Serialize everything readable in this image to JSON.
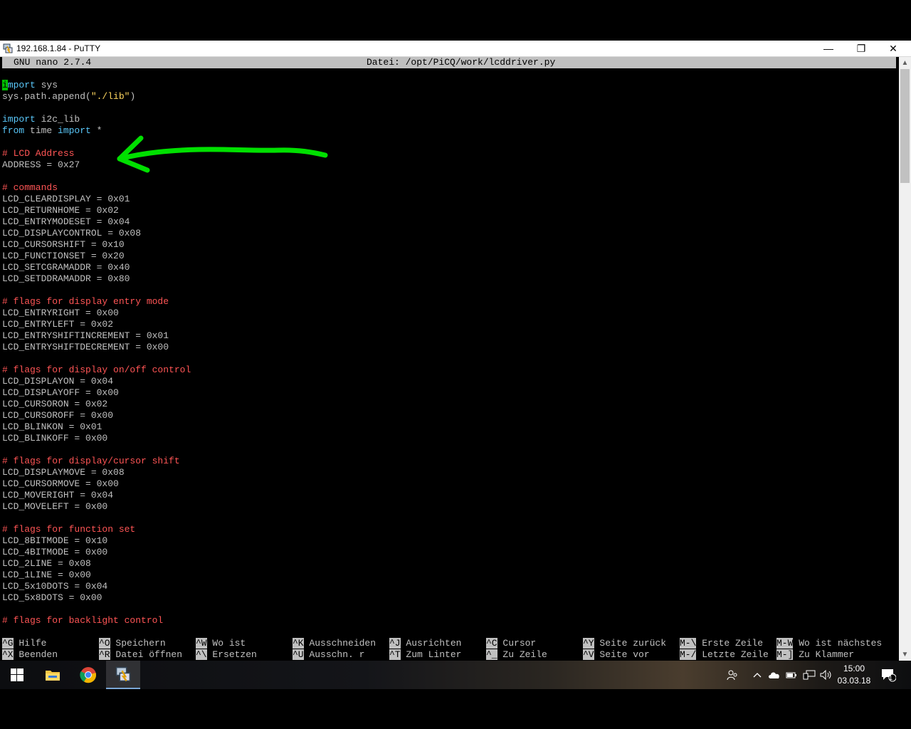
{
  "window": {
    "title": "192.168.1.84 - PuTTY",
    "controls": {
      "minimize": "—",
      "maximize": "❐",
      "close": "✕"
    }
  },
  "nano": {
    "version": "GNU nano 2.7.4",
    "file": "Datei: /opt/PiCQ/work/lcddriver.py"
  },
  "code_lines": [
    [
      {
        "t": "i",
        "c": "cursor"
      },
      {
        "t": "mport",
        "c": "kw"
      },
      {
        "t": " sys",
        "c": ""
      }
    ],
    [
      {
        "t": "sys.path.append(",
        "c": ""
      },
      {
        "t": "\"./lib\"",
        "c": "str"
      },
      {
        "t": ")",
        "c": ""
      }
    ],
    [],
    [
      {
        "t": "import",
        "c": "kw"
      },
      {
        "t": " i2c_lib",
        "c": ""
      }
    ],
    [
      {
        "t": "from",
        "c": "kw"
      },
      {
        "t": " time ",
        "c": ""
      },
      {
        "t": "import",
        "c": "kw"
      },
      {
        "t": " *",
        "c": ""
      }
    ],
    [],
    [
      {
        "t": "# LCD Address",
        "c": "cm"
      }
    ],
    [
      {
        "t": "ADDRESS = 0x27",
        "c": ""
      }
    ],
    [],
    [
      {
        "t": "# commands",
        "c": "cm"
      }
    ],
    [
      {
        "t": "LCD_CLEARDISPLAY = 0x01",
        "c": ""
      }
    ],
    [
      {
        "t": "LCD_RETURNHOME = 0x02",
        "c": ""
      }
    ],
    [
      {
        "t": "LCD_ENTRYMODESET = 0x04",
        "c": ""
      }
    ],
    [
      {
        "t": "LCD_DISPLAYCONTROL = 0x08",
        "c": ""
      }
    ],
    [
      {
        "t": "LCD_CURSORSHIFT = 0x10",
        "c": ""
      }
    ],
    [
      {
        "t": "LCD_FUNCTIONSET = 0x20",
        "c": ""
      }
    ],
    [
      {
        "t": "LCD_SETCGRAMADDR = 0x40",
        "c": ""
      }
    ],
    [
      {
        "t": "LCD_SETDDRAMADDR = 0x80",
        "c": ""
      }
    ],
    [],
    [
      {
        "t": "# flags for display entry mode",
        "c": "cm"
      }
    ],
    [
      {
        "t": "LCD_ENTRYRIGHT = 0x00",
        "c": ""
      }
    ],
    [
      {
        "t": "LCD_ENTRYLEFT = 0x02",
        "c": ""
      }
    ],
    [
      {
        "t": "LCD_ENTRYSHIFTINCREMENT = 0x01",
        "c": ""
      }
    ],
    [
      {
        "t": "LCD_ENTRYSHIFTDECREMENT = 0x00",
        "c": ""
      }
    ],
    [],
    [
      {
        "t": "# flags for display on/off control",
        "c": "cm"
      }
    ],
    [
      {
        "t": "LCD_DISPLAYON = 0x04",
        "c": ""
      }
    ],
    [
      {
        "t": "LCD_DISPLAYOFF = 0x00",
        "c": ""
      }
    ],
    [
      {
        "t": "LCD_CURSORON = 0x02",
        "c": ""
      }
    ],
    [
      {
        "t": "LCD_CURSOROFF = 0x00",
        "c": ""
      }
    ],
    [
      {
        "t": "LCD_BLINKON = 0x01",
        "c": ""
      }
    ],
    [
      {
        "t": "LCD_BLINKOFF = 0x00",
        "c": ""
      }
    ],
    [],
    [
      {
        "t": "# flags for display/cursor shift",
        "c": "cm"
      }
    ],
    [
      {
        "t": "LCD_DISPLAYMOVE = 0x08",
        "c": ""
      }
    ],
    [
      {
        "t": "LCD_CURSORMOVE = 0x00",
        "c": ""
      }
    ],
    [
      {
        "t": "LCD_MOVERIGHT = 0x04",
        "c": ""
      }
    ],
    [
      {
        "t": "LCD_MOVELEFT = 0x00",
        "c": ""
      }
    ],
    [],
    [
      {
        "t": "# flags for function set",
        "c": "cm"
      }
    ],
    [
      {
        "t": "LCD_8BITMODE = 0x10",
        "c": ""
      }
    ],
    [
      {
        "t": "LCD_4BITMODE = 0x00",
        "c": ""
      }
    ],
    [
      {
        "t": "LCD_2LINE = 0x08",
        "c": ""
      }
    ],
    [
      {
        "t": "LCD_1LINE = 0x00",
        "c": ""
      }
    ],
    [
      {
        "t": "LCD_5x10DOTS = 0x04",
        "c": ""
      }
    ],
    [
      {
        "t": "LCD_5x8DOTS = 0x00",
        "c": ""
      }
    ],
    [],
    [
      {
        "t": "# flags for backlight control",
        "c": "cm"
      }
    ]
  ],
  "shortcuts": [
    [
      {
        "key": "^G",
        "label": " Hilfe"
      },
      {
        "key": "^O",
        "label": " Speichern"
      },
      {
        "key": "^W",
        "label": " Wo ist"
      },
      {
        "key": "^K",
        "label": " Ausschneiden"
      },
      {
        "key": "^J",
        "label": " Ausrichten"
      },
      {
        "key": "^C",
        "label": " Cursor"
      },
      {
        "key": "^Y",
        "label": " Seite zurück"
      },
      {
        "key": "M-\\",
        "label": " Erste Zeile"
      },
      {
        "key": "M-W",
        "label": " Wo ist nächstes"
      }
    ],
    [
      {
        "key": "^X",
        "label": " Beenden"
      },
      {
        "key": "^R",
        "label": " Datei öffnen"
      },
      {
        "key": "^\\",
        "label": " Ersetzen"
      },
      {
        "key": "^U",
        "label": " Ausschn. r"
      },
      {
        "key": "^T",
        "label": " Zum Linter"
      },
      {
        "key": "^_",
        "label": " Zu Zeile"
      },
      {
        "key": "^V",
        "label": " Seite vor"
      },
      {
        "key": "M-/",
        "label": " Letzte Zeile"
      },
      {
        "key": "M-]",
        "label": " Zu Klammer"
      }
    ]
  ],
  "taskbar": {
    "clock_time": "15:00",
    "clock_date": "03.03.18",
    "notification_count": "1"
  },
  "colors": {
    "annotation_arrow": "#00e000",
    "comment": "#ff5555",
    "keyword": "#5ac8fa",
    "string": "#ffd75f"
  }
}
